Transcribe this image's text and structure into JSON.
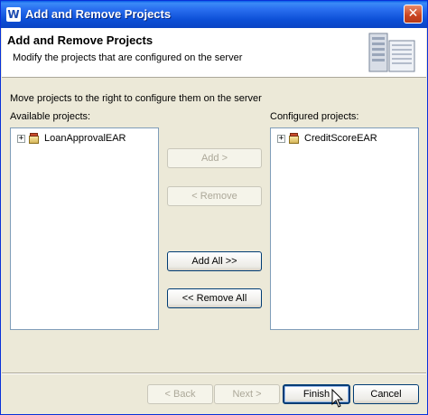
{
  "window": {
    "title": "Add and Remove Projects",
    "app_icon_glyph": "W"
  },
  "banner": {
    "title": "Add and Remove Projects",
    "description": "Modify the projects that are configured on the server",
    "graphic": "server-icon"
  },
  "main": {
    "instruction": "Move projects to the right to configure them on the server",
    "available": {
      "label": "Available projects:",
      "items": [
        {
          "label": "LoanApprovalEAR",
          "icon": "ear-project-icon",
          "expander": "+"
        }
      ]
    },
    "configured": {
      "label": "Configured projects:",
      "items": [
        {
          "label": "CreditScoreEAR",
          "icon": "ear-project-icon",
          "expander": "+"
        }
      ]
    },
    "buttons": {
      "add": "Add >",
      "remove": "< Remove",
      "add_all": "Add All >>",
      "remove_all": "<< Remove All"
    }
  },
  "footer": {
    "back": "< Back",
    "next": "Next >",
    "finish": "Finish",
    "cancel": "Cancel"
  },
  "colors": {
    "titlebar": "#0a44c4",
    "face": "#ece9d8",
    "list_border": "#7f9db9",
    "disabled_text": "#aca899"
  }
}
